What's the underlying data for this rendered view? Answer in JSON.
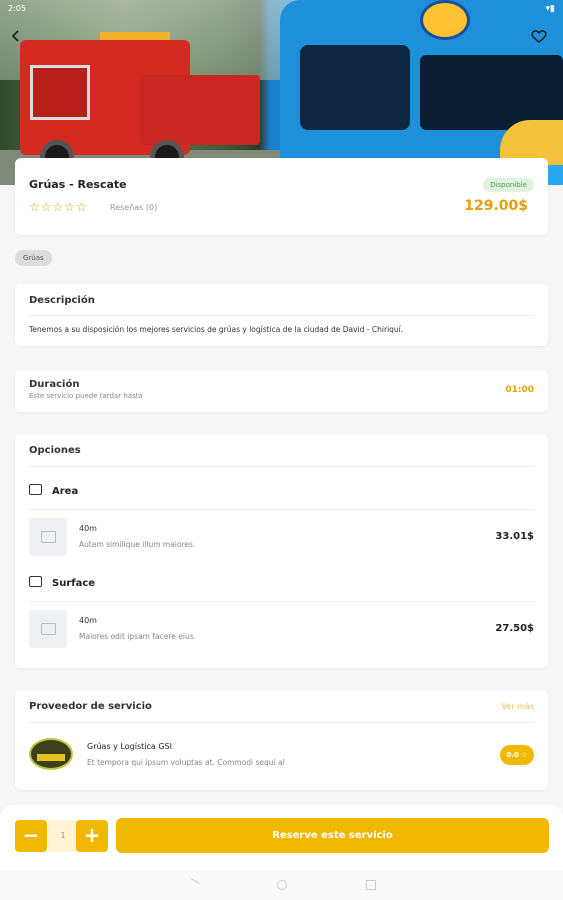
{
  "status_bar": {
    "time": "2:05",
    "battery": "▾▮"
  },
  "hero": {
    "back_icon": "back-arrow-icon",
    "favorite_icon": "heart-icon"
  },
  "service": {
    "title": "Grúas - Rescate",
    "stars": "☆☆☆☆☆",
    "reviews_label": "Reseñas (0)",
    "availability": "Disponible",
    "price": "129.00$"
  },
  "category_chip": "Grúas",
  "description": {
    "title": "Descripción",
    "text": "Tenemos a su disposición los mejores servicios de grúas y logística de la ciudad de David - Chiriquí."
  },
  "duration": {
    "title": "Duración",
    "subtitle": "Este servicio puede tardar hasta",
    "value": "01:00"
  },
  "options": {
    "title": "Opciones",
    "groups": [
      {
        "name": "Area",
        "items": [
          {
            "name": "40m",
            "description": "Autem similique illum maiores.",
            "price": "33.01$"
          }
        ]
      },
      {
        "name": "Surface",
        "items": [
          {
            "name": "40m",
            "description": "Maiores odit ipsam facere eius.",
            "price": "27.50$"
          }
        ]
      }
    ]
  },
  "provider": {
    "title": "Proveedor de servicio",
    "see_more": "Ver más",
    "name": "Grúas y Logística GSI",
    "description": "Et tempora qui ipsum voluptas at. Commodi sequi al",
    "rating": "0.0 ☆"
  },
  "booking": {
    "minus": "−",
    "quantity": "1",
    "plus": "+",
    "reserve_label": "Reserve este servicio"
  },
  "colors": {
    "accent": "#f0b800",
    "price": "#e4a000",
    "available_bg": "#e0f3df"
  }
}
